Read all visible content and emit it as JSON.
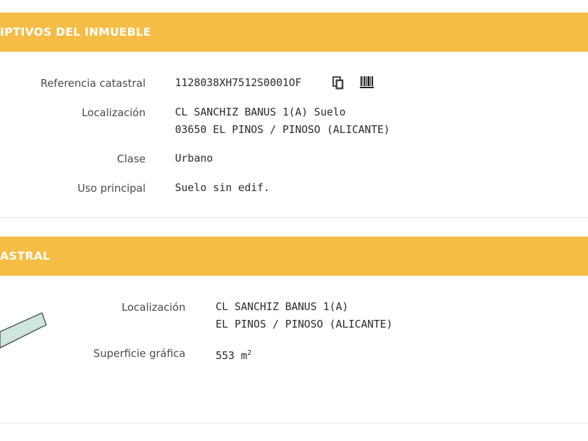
{
  "section1": {
    "title": "IPTIVOS DEL INMUEBLE",
    "fields": {
      "ref_label": "Referencia catastral",
      "ref_value": "1128038XH7512S0001OF",
      "loc_label": "Localización",
      "loc_line1": "CL SANCHIZ BANUS 1(A) Suelo",
      "loc_line2": "03650 EL PINOS / PINOSO (ALICANTE)",
      "clase_label": "Clase",
      "clase_value": "Urbano",
      "uso_label": "Uso principal",
      "uso_value": "Suelo sin edif."
    }
  },
  "section2": {
    "title": "ASTRAL",
    "fields": {
      "loc_label": "Localización",
      "loc_line1": "CL SANCHIZ BANUS 1(A)",
      "loc_line2": "EL PINOS / PINOSO (ALICANTE)",
      "sup_label": "Superficie gráfica",
      "sup_value": "553 m",
      "sup_exp": "2"
    }
  },
  "icons": [
    "copy-icon",
    "barcode-icon",
    "parcel-map-shape"
  ],
  "colors": {
    "header_bg": "#f5bd45",
    "header_text": "#ffffff",
    "parcel_fill": "#cfe6de",
    "parcel_stroke": "#4a5a55"
  }
}
